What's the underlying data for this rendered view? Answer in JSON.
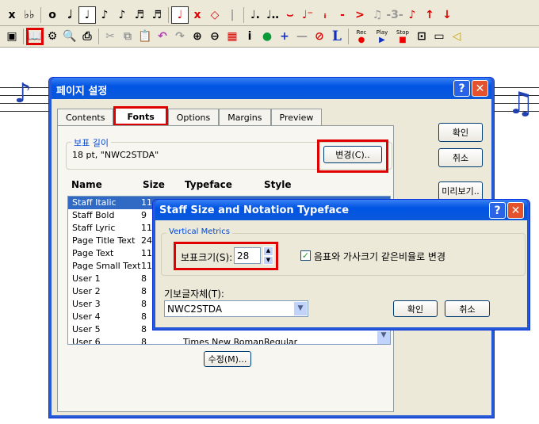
{
  "toolbar1": {
    "icons": [
      "x-natural-icon",
      "double-flat-icon",
      "whole-note-icon",
      "half-note-icon",
      "quarter-note-icon",
      "eighth-note-icon",
      "sixteenth-note-icon",
      "32nd-note-icon",
      "64th-note-icon",
      "red-quarter-note-icon",
      "x-notehead-icon",
      "diamond-notehead-icon",
      "stem-icon",
      "dotted-icon",
      "double-dotted-icon",
      "tie-icon",
      "slur-icon",
      "staccato-icon",
      "tenuto-icon",
      "accent-icon",
      "beam-icon",
      "triplet-icon",
      "grace-note-icon",
      "stem-up-icon",
      "stem-down-icon"
    ]
  },
  "toolbar2": {
    "rec_label": "Rec",
    "play_label": "Play",
    "stop_label": "Stop"
  },
  "page_setup": {
    "title": "페이지 설정",
    "tabs": [
      "Contents",
      "Fonts",
      "Options",
      "Margins",
      "Preview"
    ],
    "active_tab": "Fonts",
    "staff_group_label": "보표 길이",
    "staff_font_value": "18 pt, \"NWC2STDA\"",
    "change_button": "변경(C)..",
    "ok_button": "확인",
    "cancel_button": "취소",
    "preview_button": "미리보기..",
    "columns": [
      "Name",
      "Size",
      "Typeface",
      "Style"
    ],
    "rows": [
      {
        "name": "Staff Italic",
        "size": "11"
      },
      {
        "name": "Staff Bold",
        "size": "9"
      },
      {
        "name": "Staff Lyric",
        "size": "11"
      },
      {
        "name": "Page Title Text",
        "size": "24"
      },
      {
        "name": "Page Text",
        "size": "11"
      },
      {
        "name": "Page Small Text",
        "size": "11"
      },
      {
        "name": "User 1",
        "size": "8"
      },
      {
        "name": "User 2",
        "size": "8"
      },
      {
        "name": "User 3",
        "size": "8"
      },
      {
        "name": "User 4",
        "size": "8"
      },
      {
        "name": "User 5",
        "size": "8"
      },
      {
        "name": "User 6",
        "size": "8",
        "typeface": "Times New Roman",
        "style": "Regular"
      }
    ],
    "modify_button": "수정(M)..."
  },
  "staff_dialog": {
    "title": "Staff Size and Notation Typeface",
    "group_label": "Vertical Metrics",
    "staff_size_label": "보표크기(S):",
    "staff_size_value": "28",
    "checkbox_label": "음표와 가사크기 같은비율로 변경",
    "checkbox_checked": true,
    "typeface_label": "기보글자체(T):",
    "typeface_value": "NWC2STDA",
    "ok_button": "확인",
    "cancel_button": "취소"
  },
  "colors": {
    "highlight": "#e00000",
    "selection": "#316ac5",
    "titlebar": "#0054e3"
  }
}
